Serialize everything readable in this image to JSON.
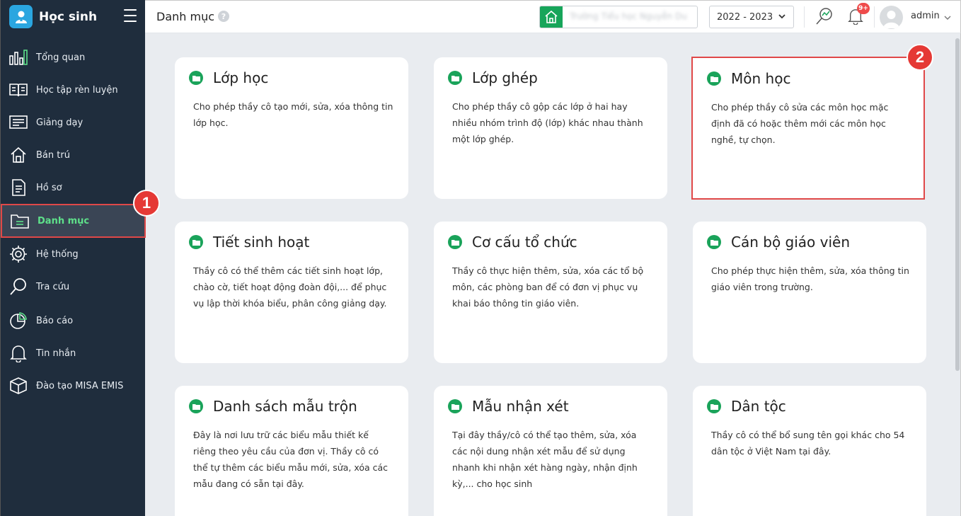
{
  "app": {
    "title": "Học sinh"
  },
  "sidebar": {
    "items": [
      {
        "label": "Tổng quan",
        "icon": "bar-chart-icon"
      },
      {
        "label": "Học tập rèn luyện",
        "icon": "book-icon"
      },
      {
        "label": "Giảng dạy",
        "icon": "board-icon"
      },
      {
        "label": "Bán trú",
        "icon": "house-icon"
      },
      {
        "label": "Hồ sơ",
        "icon": "document-icon"
      },
      {
        "label": "Danh mục",
        "icon": "folder-icon",
        "active": true
      },
      {
        "label": "Hệ thống",
        "icon": "gear-icon"
      },
      {
        "label": "Tra cứu",
        "icon": "search-icon"
      },
      {
        "label": "Báo cáo",
        "icon": "pie-chart-icon"
      },
      {
        "label": "Tin nhắn",
        "icon": "bell-icon"
      },
      {
        "label": "Đào tạo MISA EMIS",
        "icon": "box-icon"
      }
    ]
  },
  "header": {
    "title": "Danh mục",
    "help": "?",
    "school_name": "Trường Tiểu học Nguyễn Du",
    "year": "2022 - 2023",
    "notif_count": "9+",
    "user": "admin"
  },
  "annotations": {
    "first": "1",
    "second": "2"
  },
  "cards": [
    {
      "title": "Lớp học",
      "desc": "Cho phép thầy cô tạo mới, sửa, xóa thông tin lớp học."
    },
    {
      "title": "Lớp ghép",
      "desc": "Cho phép thầy cô gộp các lớp ở hai hay nhiều nhóm trình độ (lớp) khác nhau thành một lớp ghép."
    },
    {
      "title": "Môn học",
      "desc": "Cho phép thầy cô sửa các môn học mặc định đã có hoặc thêm mới các môn học nghề, tự chọn."
    },
    {
      "title": "Tiết sinh hoạt",
      "desc": "Thầy cô có thể thêm các tiết sinh hoạt lớp, chào cờ, tiết hoạt động đoàn đội,... để phục vụ lập thời khóa biểu, phân công giảng dạy."
    },
    {
      "title": "Cơ cấu tổ chức",
      "desc": "Thầy cô thực hiện thêm, sửa, xóa các tổ bộ môn, các phòng ban để có đơn vị phục vụ khai báo thông tin giáo viên."
    },
    {
      "title": "Cán bộ giáo viên",
      "desc": "Cho phép thực hiện thêm, sửa, xóa thông tin giáo viên trong trường."
    },
    {
      "title": "Danh sách mẫu trộn",
      "desc": "Đây là nơi lưu trữ các biểu mẫu thiết kế riêng theo yêu cầu của đơn vị. Thầy cô có thể tự thêm các biểu mẫu mới, sửa, xóa các mẫu đang có sẵn tại đây."
    },
    {
      "title": "Mẫu nhận xét",
      "desc": "Tại đây thầy/cô có thể tạo thêm, sửa, xóa các nội dung nhận xét mẫu để sử dụng nhanh khi nhận xét hàng ngày, nhận định kỳ,... cho học sinh"
    },
    {
      "title": "Dân tộc",
      "desc": "Thầy cô có thể bổ sung tên gọi khác cho 54 dân tộc ở Việt Nam tại đây."
    }
  ]
}
